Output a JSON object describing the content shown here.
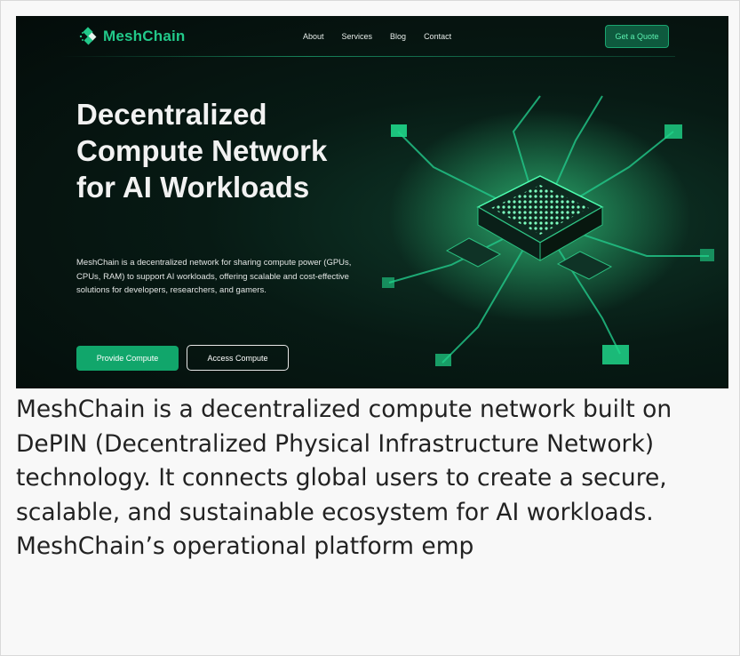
{
  "brand": {
    "name": "MeshChain",
    "accent": "#22c98a"
  },
  "nav": {
    "items": [
      "About",
      "Services",
      "Blog",
      "Contact"
    ],
    "cta": "Get a Quote"
  },
  "hero": {
    "title": "Decentralized Compute Network for AI Workloads",
    "description": "MeshChain is a decentralized network for sharing compute power (GPUs, CPUs, RAM) to support AI workloads, offering scalable and cost-effective solutions for developers, researchers, and gamers.",
    "primary_button": "Provide Compute",
    "secondary_button": "Access Compute",
    "image_icon": "glowing-chip-network-icon"
  },
  "caption": {
    "text": "MeshChain is a decentralized compute network built on DePIN (Decentralized Physical Infrastructure Network) technology. It connects global users to create a secure, scalable, and sustainable ecosystem for AI workloads. MeshChain’s operational platform emp"
  }
}
